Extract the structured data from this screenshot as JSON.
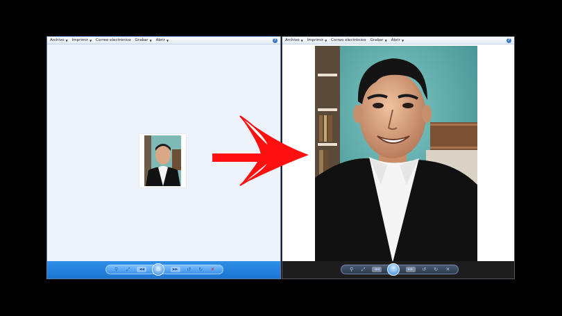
{
  "windows": [
    {
      "menu": [
        {
          "label": "Archivo"
        },
        {
          "label": "Imprimir"
        },
        {
          "label": "Correo electrónico"
        },
        {
          "label": "Grabar"
        },
        {
          "label": "Abrir"
        }
      ],
      "help": "?",
      "theme": "light-blue"
    },
    {
      "menu": [
        {
          "label": "Archivo"
        },
        {
          "label": "Imprimir"
        },
        {
          "label": "Correo electrónico"
        },
        {
          "label": "Grabar"
        },
        {
          "label": "Abrir"
        }
      ],
      "help": "?",
      "theme": "dark"
    }
  ],
  "controls": [
    "zoom-icon",
    "fit-icon",
    "previous-icon",
    "slideshow-play-icon",
    "next-icon",
    "rotate-left-icon",
    "rotate-right-icon",
    "delete-icon"
  ],
  "colors": {
    "arrow": "#ff1010",
    "left_bottombar": "#1f7ad6",
    "right_bottombar": "#1d1d1d"
  }
}
